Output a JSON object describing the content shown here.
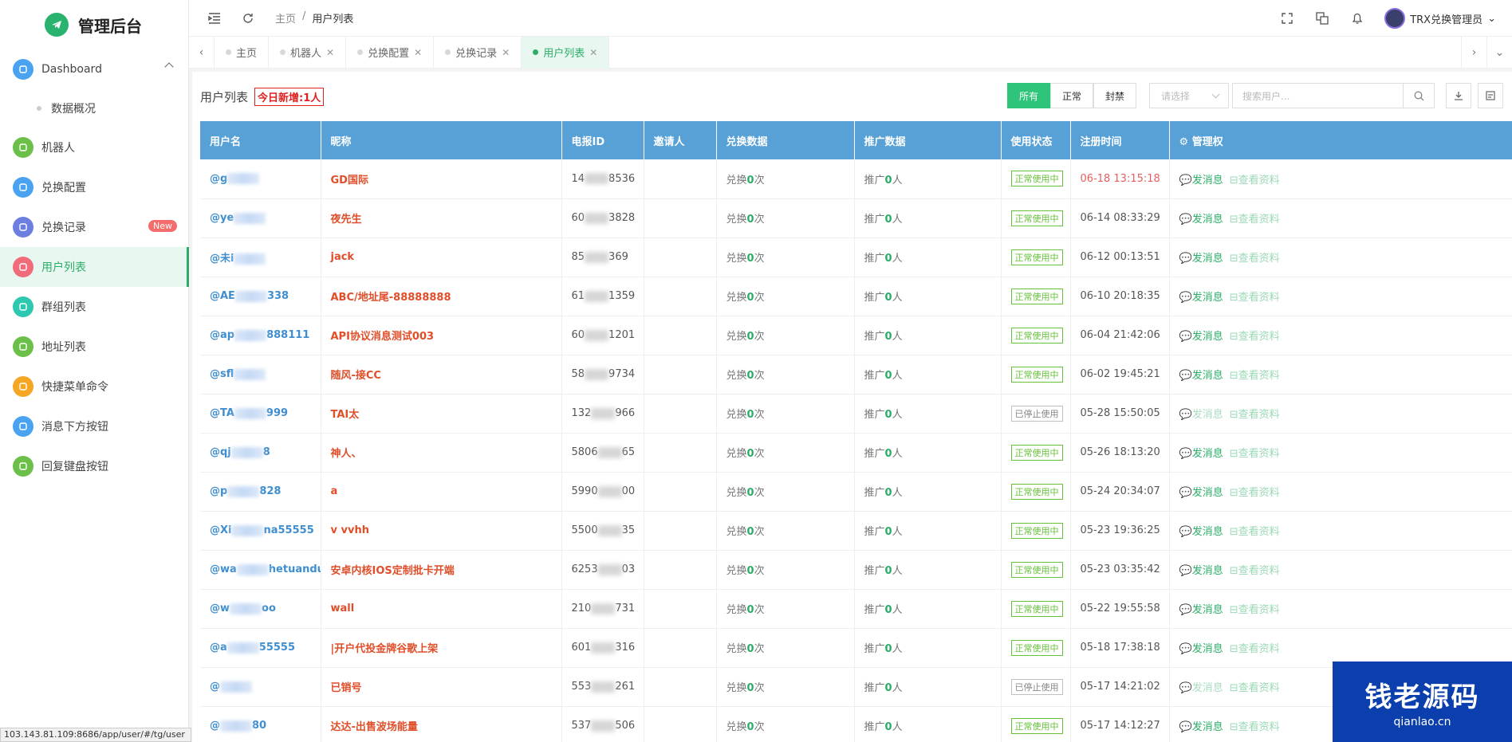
{
  "app": {
    "title": "管理后台"
  },
  "sidebar": {
    "items": [
      {
        "label": "Dashboard",
        "color": "#4aa3f0",
        "icon": "home-icon"
      },
      {
        "label": "数据概况",
        "sub": true
      },
      {
        "label": "机器人",
        "color": "#6cc04a",
        "icon": "monitor-icon"
      },
      {
        "label": "兑换配置",
        "color": "#4aa3f0",
        "icon": "settings-icon"
      },
      {
        "label": "兑换记录",
        "color": "#6c7ee0",
        "icon": "document-icon",
        "badge": "New"
      },
      {
        "label": "用户列表",
        "color": "#f06c7a",
        "icon": "user-icon",
        "active": true
      },
      {
        "label": "群组列表",
        "color": "#2cc8b0",
        "icon": "group-icon"
      },
      {
        "label": "地址列表",
        "color": "#6cc04a",
        "icon": "box-icon"
      },
      {
        "label": "快捷菜单命令",
        "color": "#f5a623",
        "icon": "sliders-icon"
      },
      {
        "label": "消息下方按钮",
        "color": "#4aa3f0",
        "icon": "button-icon"
      },
      {
        "label": "回复键盘按钮",
        "color": "#6cc04a",
        "icon": "keyboard-icon"
      }
    ]
  },
  "header": {
    "crumb_home": "主页",
    "crumb_sep": "/",
    "crumb_current": "用户列表",
    "user_name": "TRX兑换管理员"
  },
  "tabs": [
    {
      "label": "主页",
      "closable": false
    },
    {
      "label": "机器人",
      "closable": true
    },
    {
      "label": "兑换配置",
      "closable": true
    },
    {
      "label": "兑换记录",
      "closable": true
    },
    {
      "label": "用户列表",
      "closable": true,
      "active": true
    }
  ],
  "toolbar": {
    "title": "用户列表",
    "today": "今日新增:1人",
    "filters": [
      "所有",
      "正常",
      "封禁"
    ],
    "select_placeholder": "请选择",
    "search_placeholder": "搜索用户..."
  },
  "table": {
    "headers": [
      "用户名",
      "昵称",
      "电报ID",
      "邀请人",
      "兑换数据",
      "推广数据",
      "使用状态",
      "注册时间",
      "管理权"
    ],
    "manage_icon": "⚙",
    "action_send": "发消息",
    "action_view": "查看资料",
    "rows": [
      {
        "u1": "@g",
        "u2": "",
        "nick": "GD国际",
        "id1": "14",
        "id2": "8536",
        "ex_pre": "兑换",
        "ex": "0",
        "ex_suf": "次",
        "pr_pre": "推广",
        "pr": "0",
        "pr_suf": "人",
        "status": "正常使用中",
        "on": true,
        "time": "06-18 13:15:18",
        "red": true
      },
      {
        "u1": "@ye",
        "u2": "",
        "nick": "夜先生",
        "id1": "60",
        "id2": "3828",
        "ex_pre": "兑换",
        "ex": "0",
        "ex_suf": "次",
        "pr_pre": "推广",
        "pr": "0",
        "pr_suf": "人",
        "status": "正常使用中",
        "on": true,
        "time": "06-14 08:33:29"
      },
      {
        "u1": "@未i",
        "u2": "",
        "nick": "jack",
        "id1": "85",
        "id2": "369",
        "ex_pre": "兑换",
        "ex": "0",
        "ex_suf": "次",
        "pr_pre": "推广",
        "pr": "0",
        "pr_suf": "人",
        "status": "正常使用中",
        "on": true,
        "time": "06-12 00:13:51"
      },
      {
        "u1": "@AE",
        "u2": "338",
        "nick": "ABC/地址尾-88888888",
        "id1": "61",
        "id2": "1359",
        "ex_pre": "兑换",
        "ex": "0",
        "ex_suf": "次",
        "pr_pre": "推广",
        "pr": "0",
        "pr_suf": "人",
        "status": "正常使用中",
        "on": true,
        "time": "06-10 20:18:35"
      },
      {
        "u1": "@ap",
        "u2": "888111",
        "nick": "API协议消息测试003",
        "id1": "60",
        "id2": "1201",
        "ex_pre": "兑换",
        "ex": "0",
        "ex_suf": "次",
        "pr_pre": "推广",
        "pr": "0",
        "pr_suf": "人",
        "status": "正常使用中",
        "on": true,
        "time": "06-04 21:42:06"
      },
      {
        "u1": "@sfl",
        "u2": "",
        "nick": "随风-接CC",
        "id1": "58",
        "id2": "9734",
        "ex_pre": "兑换",
        "ex": "0",
        "ex_suf": "次",
        "pr_pre": "推广",
        "pr": "0",
        "pr_suf": "人",
        "status": "正常使用中",
        "on": true,
        "time": "06-02 19:45:21"
      },
      {
        "u1": "@TA",
        "u2": "999",
        "nick": "TAI太",
        "id1": "132",
        "id2": "966",
        "ex_pre": "兑换",
        "ex": "0",
        "ex_suf": "次",
        "pr_pre": "推广",
        "pr": "0",
        "pr_suf": "人",
        "status": "已停止使用",
        "on": false,
        "time": "05-28 15:50:05"
      },
      {
        "u1": "@qj",
        "u2": "8",
        "nick": "神人、",
        "id1": "5806",
        "id2": "65",
        "ex_pre": "兑换",
        "ex": "0",
        "ex_suf": "次",
        "pr_pre": "推广",
        "pr": "0",
        "pr_suf": "人",
        "status": "正常使用中",
        "on": true,
        "time": "05-26 18:13:20"
      },
      {
        "u1": "@p",
        "u2": "828",
        "nick": "a",
        "id1": "5990",
        "id2": "00",
        "ex_pre": "兑换",
        "ex": "0",
        "ex_suf": "次",
        "pr_pre": "推广",
        "pr": "0",
        "pr_suf": "人",
        "status": "正常使用中",
        "on": true,
        "time": "05-24 20:34:07"
      },
      {
        "u1": "@Xi",
        "u2": "na55555",
        "nick": "v vvhh",
        "id1": "5500",
        "id2": "35",
        "ex_pre": "兑换",
        "ex": "0",
        "ex_suf": "次",
        "pr_pre": "推广",
        "pr": "0",
        "pr_suf": "人",
        "status": "正常使用中",
        "on": true,
        "time": "05-23 19:36:25"
      },
      {
        "u1": "@wa",
        "u2": "hetuandui",
        "nick": "安卓内核IOS定制批卡开端",
        "id1": "6253",
        "id2": "03",
        "ex_pre": "兑换",
        "ex": "0",
        "ex_suf": "次",
        "pr_pre": "推广",
        "pr": "0",
        "pr_suf": "人",
        "status": "正常使用中",
        "on": true,
        "time": "05-23 03:35:42"
      },
      {
        "u1": "@w",
        "u2": "oo",
        "nick": "wall",
        "id1": "210",
        "id2": "731",
        "ex_pre": "兑换",
        "ex": "0",
        "ex_suf": "次",
        "pr_pre": "推广",
        "pr": "0",
        "pr_suf": "人",
        "status": "正常使用中",
        "on": true,
        "time": "05-22 19:55:58"
      },
      {
        "u1": "@a",
        "u2": "55555",
        "nick": "|开户代投金牌谷歌上架",
        "id1": "601",
        "id2": "316",
        "ex_pre": "兑换",
        "ex": "0",
        "ex_suf": "次",
        "pr_pre": "推广",
        "pr": "0",
        "pr_suf": "人",
        "status": "正常使用中",
        "on": true,
        "time": "05-18 17:38:18"
      },
      {
        "u1": "@",
        "u2": "",
        "nick": "已销号",
        "id1": "553",
        "id2": "261",
        "ex_pre": "兑换",
        "ex": "0",
        "ex_suf": "次",
        "pr_pre": "推广",
        "pr": "0",
        "pr_suf": "人",
        "status": "已停止使用",
        "on": false,
        "time": "05-17 14:21:02"
      },
      {
        "u1": "@",
        "u2": "80",
        "nick": "达达-出售波场能量",
        "id1": "537",
        "id2": "506",
        "ex_pre": "兑换",
        "ex": "0",
        "ex_suf": "次",
        "pr_pre": "推广",
        "pr": "0",
        "pr_suf": "人",
        "status": "正常使用中",
        "on": true,
        "time": "05-17 14:12:27"
      }
    ]
  },
  "statusbar": {
    "text": "103.143.81.109:8686/app/user/#/tg/user"
  },
  "watermark": {
    "title": "钱老源码",
    "url": "qianlao.cn"
  },
  "colors": {
    "accent": "#2aae67",
    "table_header": "#57a1d6",
    "username": "#3f8ed0",
    "nickname": "#e04e2a"
  }
}
